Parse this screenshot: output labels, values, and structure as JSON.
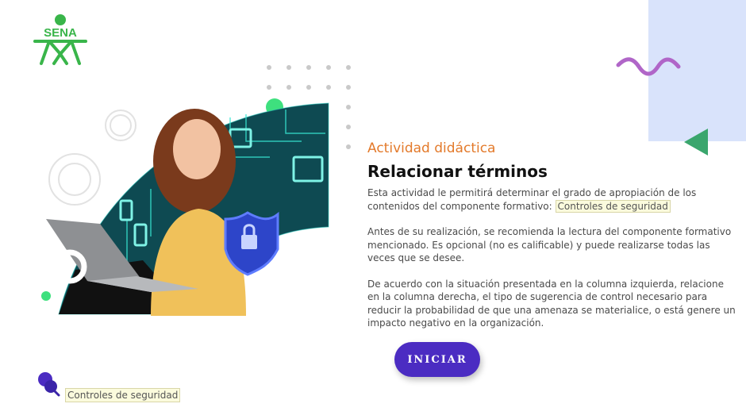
{
  "brand": {
    "logo_text": "SENA"
  },
  "activity": {
    "kicker": "Actividad didáctica",
    "title": "Relacionar términos",
    "intro_prefix": "Esta actividad le permitirá determinar el grado de apropiación de los contenidos del componente formativo: ",
    "component_name": "Controles de seguridad",
    "paragraph2": "Antes de su realización, se recomienda la lectura del componente formativo mencionado.  Es opcional (no es calificable) y puede realizarse todas las veces que se desee.",
    "paragraph3": "De acuerdo con la situación presentada en la columna izquierda, relacione en la columna derecha, el tipo de sugerencia de control necesario para reducir la probabilidad de que una amenaza se materialice, o está genere un impacto negativo en la organización."
  },
  "start_button": {
    "label": "INICIAR"
  },
  "footer": {
    "label": "Controles de seguridad"
  },
  "colors": {
    "accent_orange": "#e37a2b",
    "button_purple": "#4b2cc2",
    "brand_green": "#39b54a",
    "panel_blue": "#d9e3fb",
    "squiggle_pink": "#b066c8",
    "triangle_green": "#3aa66d"
  },
  "icons": [
    "sena-logo",
    "lock-shield-icon",
    "pin-icon",
    "squiggle-decoration",
    "triangle-decoration"
  ]
}
